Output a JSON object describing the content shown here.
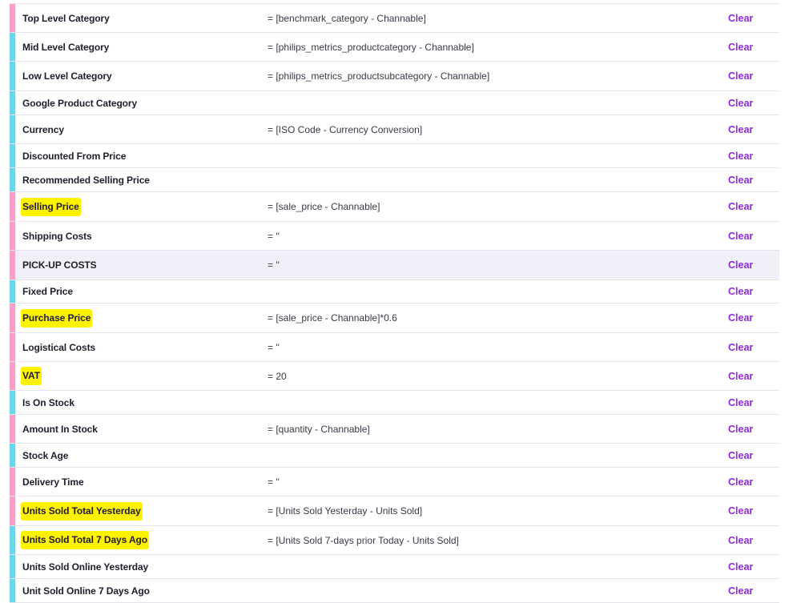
{
  "clear_label": "Clear",
  "colors": {
    "pink_marker": "#f7a1c8",
    "cyan_marker": "#6ed6ec",
    "clear_link": "#8e2bd9",
    "highlight": "#fff200"
  },
  "rows": [
    {
      "name": "Top Level Category",
      "value": "= [benchmark_category - Channable]",
      "marker": "pink",
      "highlighted": false,
      "selected": false
    },
    {
      "name": "Mid Level Category",
      "value": "= [philips_metrics_productcategory - Channable]",
      "marker": "cyan",
      "highlighted": false,
      "selected": false
    },
    {
      "name": "Low Level Category",
      "value": "= [philips_metrics_productsubcategory - Channable]",
      "marker": "cyan",
      "highlighted": false,
      "selected": false
    },
    {
      "name": "Google Product Category",
      "value": "",
      "marker": "cyan",
      "highlighted": false,
      "selected": false
    },
    {
      "name": "Currency",
      "value": "= [ISO Code - Currency Conversion]",
      "marker": "cyan",
      "highlighted": false,
      "selected": false
    },
    {
      "name": "Discounted From Price",
      "value": "",
      "marker": "cyan",
      "highlighted": false,
      "selected": false
    },
    {
      "name": "Recommended Selling Price",
      "value": "",
      "marker": "cyan",
      "highlighted": false,
      "selected": false
    },
    {
      "name": "Selling Price",
      "value": "= [sale_price - Channable]",
      "marker": "pink",
      "highlighted": true,
      "selected": false
    },
    {
      "name": "Shipping Costs",
      "value": "= ''",
      "marker": "pink",
      "highlighted": false,
      "selected": false
    },
    {
      "name": "PICK-UP COSTS",
      "value": "= ''",
      "marker": "pink",
      "highlighted": false,
      "selected": true
    },
    {
      "name": "Fixed Price",
      "value": "",
      "marker": "cyan",
      "highlighted": false,
      "selected": false
    },
    {
      "name": "Purchase Price",
      "value": "= [sale_price - Channable]*0.6",
      "marker": "pink",
      "highlighted": true,
      "selected": false
    },
    {
      "name": "Logistical Costs",
      "value": "= ''",
      "marker": "pink",
      "highlighted": false,
      "selected": false
    },
    {
      "name": "VAT",
      "value": "= 20",
      "marker": "pink",
      "highlighted": true,
      "selected": false
    },
    {
      "name": "Is On Stock",
      "value": "",
      "marker": "cyan",
      "highlighted": false,
      "selected": false
    },
    {
      "name": "Amount In Stock",
      "value": "= [quantity - Channable]",
      "marker": "pink",
      "highlighted": false,
      "selected": false
    },
    {
      "name": "Stock Age",
      "value": "",
      "marker": "cyan",
      "highlighted": false,
      "selected": false
    },
    {
      "name": "Delivery Time",
      "value": "= ''",
      "marker": "pink",
      "highlighted": false,
      "selected": false
    },
    {
      "name": "Units Sold Total Yesterday",
      "value": "= [Units Sold Yesterday - Units Sold]",
      "marker": "pink",
      "highlighted": true,
      "selected": false
    },
    {
      "name": "Units Sold Total 7 Days Ago",
      "value": "= [Units Sold 7-days prior Today - Units Sold]",
      "marker": "cyan",
      "highlighted": true,
      "selected": false
    },
    {
      "name": "Units Sold Online Yesterday",
      "value": "",
      "marker": "cyan",
      "highlighted": false,
      "selected": false
    },
    {
      "name": "Unit Sold Online 7 Days Ago",
      "value": "",
      "marker": "cyan",
      "highlighted": false,
      "selected": false
    }
  ]
}
